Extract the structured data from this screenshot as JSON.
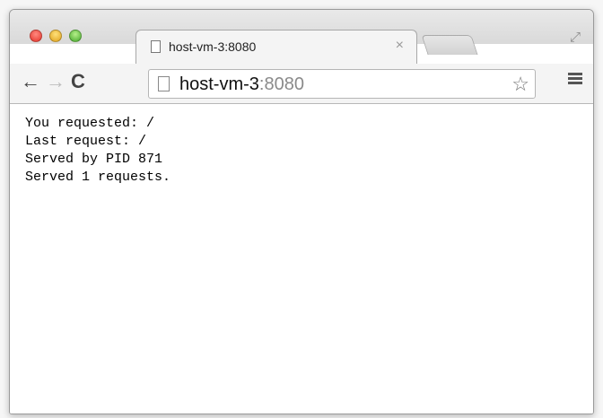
{
  "tab": {
    "title": "host-vm-3:8080",
    "close_glyph": "×"
  },
  "omnibox": {
    "host": "host-vm-3",
    "port": ":8080"
  },
  "icons": {
    "back": "←",
    "forward": "→",
    "reload": "C",
    "star": "☆",
    "fullscreen": "⤢"
  },
  "content": {
    "lines": [
      "You requested: /",
      "Last request: /",
      "Served by PID 871",
      "Served 1 requests."
    ]
  },
  "colors": {
    "close": "#e5332a",
    "minimize": "#e0a21b",
    "zoom": "#45a82b"
  }
}
